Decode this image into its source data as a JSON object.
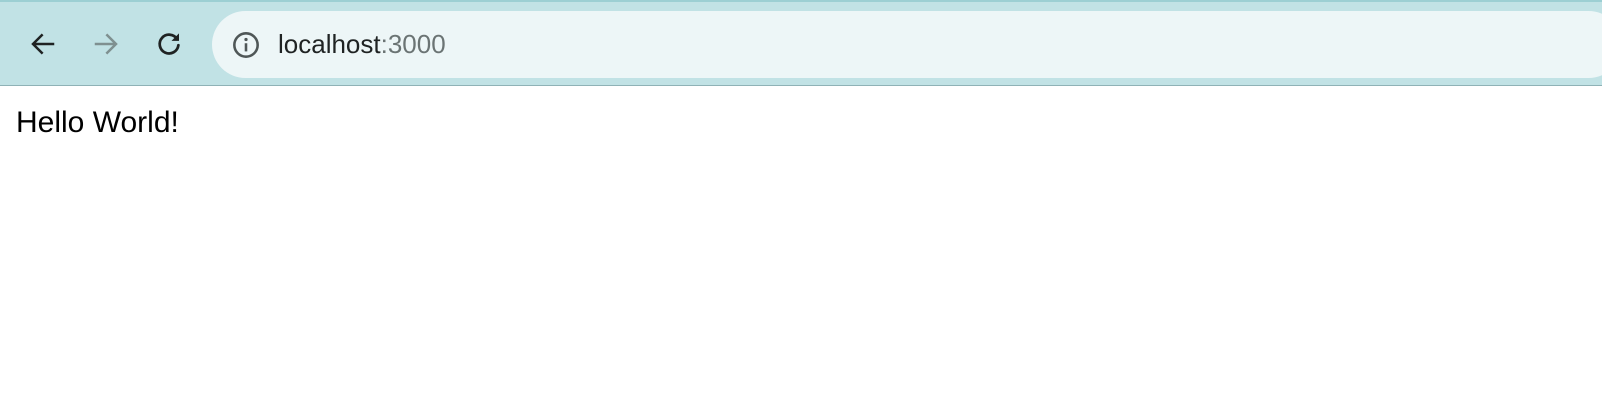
{
  "browser": {
    "address_bar": {
      "host": "localhost",
      "port": ":3000"
    },
    "icons": {
      "back": "arrow-left-icon",
      "forward": "arrow-right-icon",
      "reload": "reload-icon",
      "site_info": "info-icon"
    },
    "colors": {
      "toolbar": "#c1e2e5",
      "omnibox": "#edf6f7",
      "icon_active": "#1f2323",
      "icon_disabled": "#7f9090"
    }
  },
  "page": {
    "text": "Hello World!"
  }
}
